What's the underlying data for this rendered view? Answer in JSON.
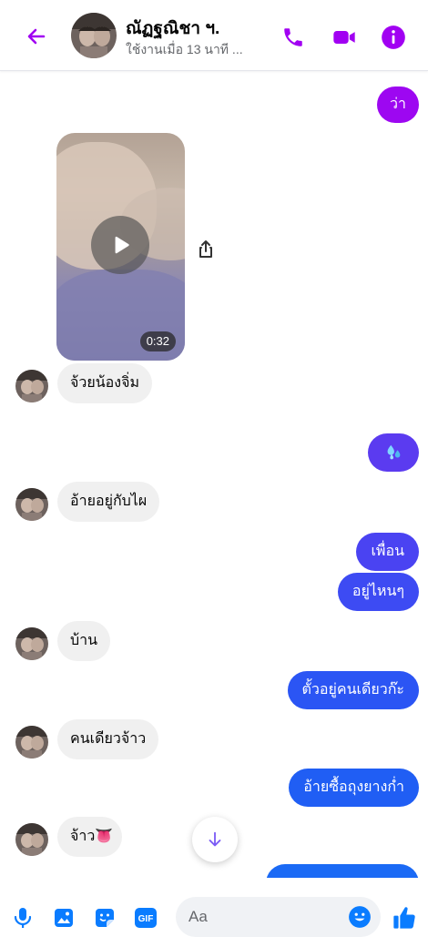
{
  "header": {
    "title": "ณัฏฐณิชา ฯ.",
    "subtitle": "ใช้งานเมื่อ 13 นาที ...",
    "icons": [
      "back-arrow-icon",
      "phone-icon",
      "video-camera-icon",
      "info-icon"
    ]
  },
  "colors": {
    "accent": "#a100f2",
    "bubble_purple": "#9d07f1",
    "bubble_indigo": "#5b3bf0",
    "bubble_blue": "#3a4cf3",
    "bubble_blue2": "#2758f4",
    "bubble_blue3": "#1b6af5",
    "incoming_bg": "#f0f0f0",
    "composer_icon": "#0a7cff"
  },
  "messages": [
    {
      "side": "out",
      "text": "ว่า"
    },
    {
      "side": "in",
      "type": "video",
      "duration": "0:32"
    },
    {
      "side": "in",
      "text": "จ้วยน้องจิ่ม"
    },
    {
      "side": "out",
      "text": "💦"
    },
    {
      "side": "in",
      "text": "อ้ายอยู่กับไผ"
    },
    {
      "side": "out",
      "text": "เพื่อน"
    },
    {
      "side": "out",
      "text": "อยู่ไหนๆ"
    },
    {
      "side": "in",
      "text": "บ้าน"
    },
    {
      "side": "out",
      "text": "ตั้วอยู่คนเดียวก๊ะ"
    },
    {
      "side": "in",
      "text": "คนเดียวจ้าว"
    },
    {
      "side": "out",
      "text": "อ้ายซื้อถุงยางก่ำ"
    },
    {
      "side": "in",
      "text": "จ้าว👅"
    }
  ],
  "composer": {
    "placeholder": "Aa",
    "icons": [
      "microphone-icon",
      "image-icon",
      "sticker-icon",
      "gif-icon",
      "emoji-icon",
      "thumbs-up-icon"
    ],
    "gif_label": "GIF"
  }
}
